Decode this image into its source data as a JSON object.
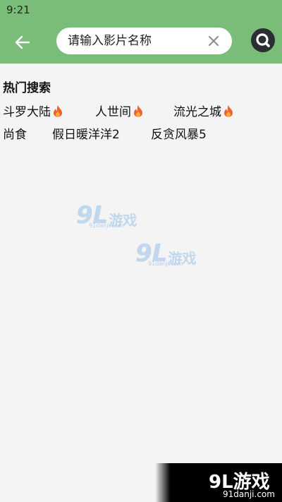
{
  "status_bar": {
    "time": "9:21"
  },
  "colors": {
    "app_bar": "#79bd78",
    "search_button": "#2b2f33",
    "background": "#f4f4f4"
  },
  "header": {
    "back_icon": "arrow-left-icon",
    "search": {
      "placeholder": "请输入影片名称",
      "value": ""
    },
    "clear_icon": "close-icon",
    "search_icon": "search-icon"
  },
  "hot_search": {
    "title": "热门搜索",
    "row1": [
      {
        "label": "斗罗大陆",
        "hot": true
      },
      {
        "label": "人世间",
        "hot": true
      },
      {
        "label": "流光之城",
        "hot": true
      }
    ],
    "row2": [
      {
        "label": "尚食",
        "hot": false
      },
      {
        "label": "假日暖洋洋2",
        "hot": false
      },
      {
        "label": "反贪风暴5",
        "hot": false
      }
    ]
  },
  "watermark": {
    "logo": "9L游戏",
    "num": "9L",
    "text": "游戏",
    "site": "91danji.com"
  }
}
